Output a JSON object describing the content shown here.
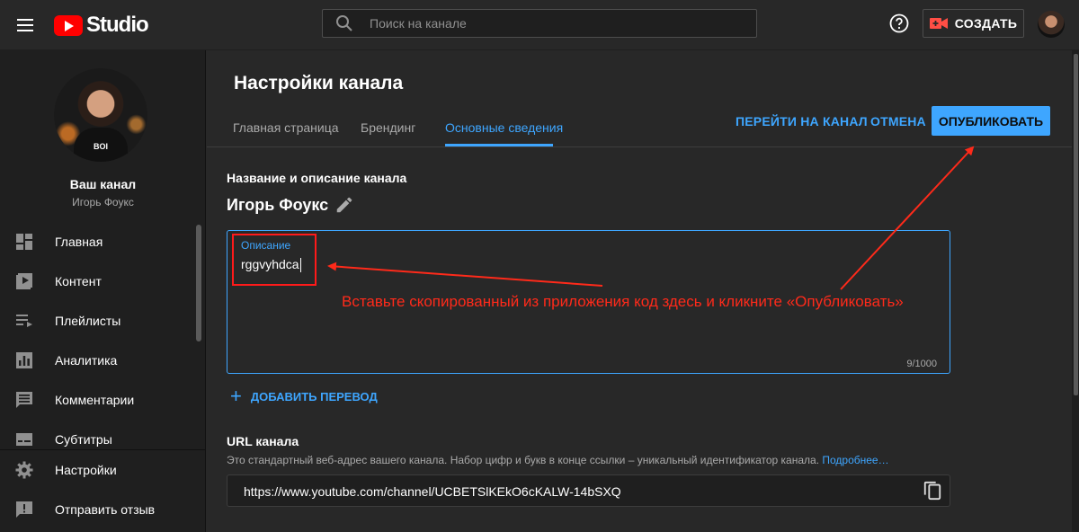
{
  "header": {
    "logo_text": "Studio",
    "search_placeholder": "Поиск на канале",
    "create_label": "СОЗДАТЬ"
  },
  "sidebar": {
    "channel_label": "Ваш канал",
    "channel_name": "Игорь Фоукс",
    "profile_shirt_text": "BOI",
    "items": [
      {
        "label": "Главная",
        "icon": "dashboard-icon"
      },
      {
        "label": "Контент",
        "icon": "video-content-icon"
      },
      {
        "label": "Плейлисты",
        "icon": "playlist-icon"
      },
      {
        "label": "Аналитика",
        "icon": "analytics-icon"
      },
      {
        "label": "Комментарии",
        "icon": "comments-icon"
      },
      {
        "label": "Субтитры",
        "icon": "subtitles-icon"
      }
    ],
    "bottom_items": [
      {
        "label": "Настройки",
        "icon": "gear-icon"
      },
      {
        "label": "Отправить отзыв",
        "icon": "feedback-icon"
      }
    ]
  },
  "main": {
    "page_title": "Настройки канала",
    "tabs": [
      {
        "label": "Главная страница",
        "active": false
      },
      {
        "label": "Брендинг",
        "active": false
      },
      {
        "label": "Основные сведения",
        "active": true
      }
    ],
    "go_to_channel_label": "ПЕРЕЙТИ НА КАНАЛ",
    "cancel_label": "ОТМЕНА",
    "publish_label": "ОПУБЛИКОВАТЬ",
    "name_section_title": "Название и описание канала",
    "channel_title": "Игорь Фоукс",
    "description": {
      "label": "Описание",
      "value": "rggvyhdca",
      "char_count": "9/1000"
    },
    "add_translation_label": "ДОБАВИТЬ ПЕРЕВОД",
    "url_section": {
      "title": "URL канала",
      "description": "Это стандартный веб-адрес вашего канала. Набор цифр и букв в конце ссылки – уникальный идентификатор канала.",
      "more_link": "Подробнее…",
      "url": "https://www.youtube.com/channel/UCBETSlKEkO6cKALW-14bSXQ"
    }
  },
  "annotation": {
    "text": "Вставьте скопированный из приложения код здесь и кликните «Опубликовать»",
    "color": "#ff2a1a"
  },
  "colors": {
    "accent": "#3ea6ff",
    "brand_red": "#ff0000",
    "background": "#282828",
    "sidebar": "#1f1f1f"
  }
}
